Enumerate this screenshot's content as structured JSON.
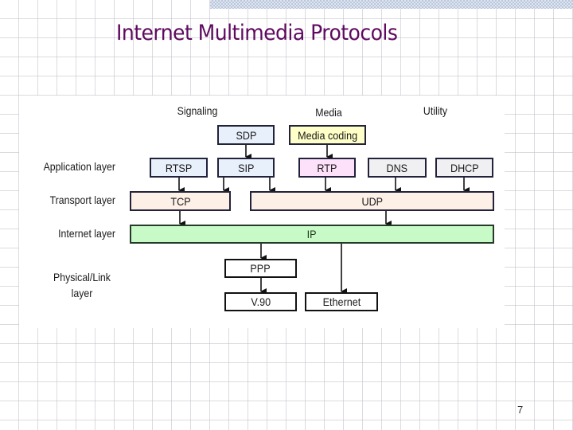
{
  "slide": {
    "title": "Internet Multimedia Protocols",
    "page_number": "7"
  },
  "diagram": {
    "columns": {
      "signaling": "Signaling",
      "media": "Media",
      "utility": "Utility"
    },
    "layers": {
      "application": "Application layer",
      "transport": "Transport layer",
      "internet": "Internet layer",
      "physical_line1": "Physical/Link",
      "physical_line2": "layer"
    },
    "boxes": {
      "sdp": "SDP",
      "media_coding": "Media coding",
      "rtsp": "RTSP",
      "sip": "SIP",
      "rtp": "RTP",
      "dns": "DNS",
      "dhcp": "DHCP",
      "tcp": "TCP",
      "udp": "UDP",
      "ip": "IP",
      "ppp": "PPP",
      "v90": "V.90",
      "ethernet": "Ethernet"
    },
    "connections": [
      {
        "from": "SDP",
        "to": "SIP"
      },
      {
        "from": "Media coding",
        "to": "RTP"
      },
      {
        "from": "RTSP",
        "to": "TCP"
      },
      {
        "from": "SIP",
        "to": "TCP"
      },
      {
        "from": "SIP",
        "to": "UDP"
      },
      {
        "from": "RTP",
        "to": "UDP"
      },
      {
        "from": "DNS",
        "to": "UDP"
      },
      {
        "from": "DHCP",
        "to": "UDP"
      },
      {
        "from": "TCP",
        "to": "IP"
      },
      {
        "from": "UDP",
        "to": "IP"
      },
      {
        "from": "IP",
        "to": "PPP"
      },
      {
        "from": "PPP",
        "to": "V.90"
      },
      {
        "from": "IP",
        "to": "Ethernet"
      }
    ],
    "colors": {
      "signaling_fill": "#e8f0fc",
      "media_coding_fill": "#ffffc8",
      "rtp_fill": "#fde0fa",
      "utility_fill": "#f0f0f2",
      "transport_fill": "#fdf0e6",
      "ip_fill": "#c8fac8",
      "title": "#5f0a5f"
    }
  }
}
